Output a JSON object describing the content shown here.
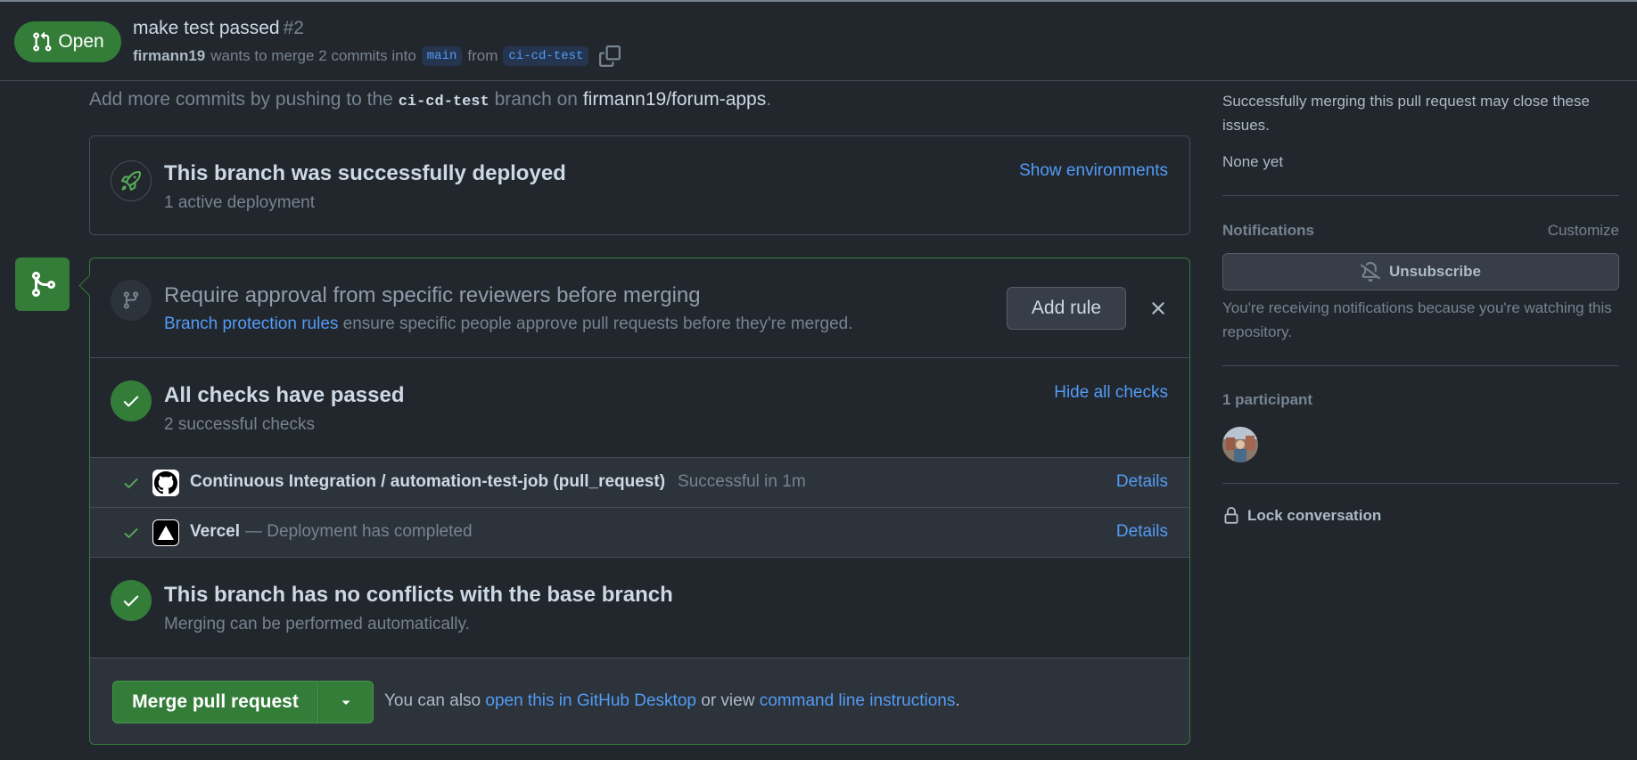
{
  "header": {
    "state": "Open",
    "title": "make test passed",
    "number": "#2",
    "author": "firmann19",
    "merge_text": "wants to merge 2 commits into",
    "base_branch": "main",
    "from_text": "from",
    "head_branch": "ci-cd-test"
  },
  "hint": {
    "prefix": "Add more commits by pushing to the",
    "branch": "ci-cd-test",
    "middle": "branch on",
    "repo": "firmann19/forum-apps",
    "suffix": "."
  },
  "deployment": {
    "title": "This branch was successfully deployed",
    "subtitle": "1 active deployment",
    "link": "Show environments"
  },
  "approval": {
    "title": "Require approval from specific reviewers before merging",
    "link": "Branch protection rules",
    "text": "ensure specific people approve pull requests before they're merged.",
    "button": "Add rule"
  },
  "checks": {
    "title": "All checks have passed",
    "subtitle": "2 successful checks",
    "link": "Hide all checks",
    "items": [
      {
        "name": "Continuous Integration / automation-test-job (pull_request)",
        "status": "Successful in 1m",
        "details": "Details"
      },
      {
        "name": "Vercel",
        "status": "— Deployment has completed",
        "details": "Details"
      }
    ]
  },
  "conflicts": {
    "title": "This branch has no conflicts with the base branch",
    "subtitle": "Merging can be performed automatically."
  },
  "merge": {
    "button": "Merge pull request",
    "text_prefix": "You can also",
    "desktop_link": "open this in GitHub Desktop",
    "text_middle": "or view",
    "cli_link": "command line instructions",
    "text_suffix": "."
  },
  "sidebar": {
    "issues_text": "Successfully merging this pull request may close these issues.",
    "issues_value": "None yet",
    "notifications_heading": "Notifications",
    "customize": "Customize",
    "unsubscribe": "Unsubscribe",
    "notifications_reason": "You're receiving notifications because you're watching this repository.",
    "participants_heading": "1 participant",
    "lock": "Lock conversation"
  },
  "colors": {
    "background": "#22272e",
    "success": "#347d39",
    "link": "#539bf5",
    "border": "#444c56"
  }
}
